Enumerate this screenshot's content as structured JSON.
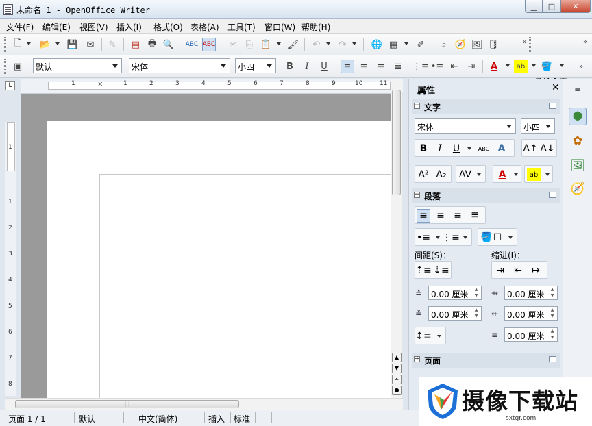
{
  "window": {
    "title": "未命名 1 - OpenOffice Writer"
  },
  "menu": [
    "文件(F)",
    "编辑(E)",
    "视图(V)",
    "插入(I)",
    "格式(O)",
    "表格(A)",
    "工具(T)",
    "窗口(W)",
    "帮助(H)"
  ],
  "toolbar": {
    "find_placeholder": "查找文字"
  },
  "format_bar": {
    "style": "默认",
    "font": "宋体",
    "size": "小四"
  },
  "ruler": {
    "h_ticks": [
      "1",
      "1",
      "2",
      "3",
      "4",
      "5",
      "6",
      "7",
      "8",
      "9",
      "10",
      "11"
    ],
    "v_ticks": [
      "1",
      "1",
      "2",
      "3",
      "4",
      "5",
      "6",
      "7",
      "8"
    ]
  },
  "sidebar": {
    "title": "属性",
    "sections": {
      "text": "文字",
      "paragraph": "段落",
      "page": "页面"
    },
    "font": "宋体",
    "size": "小四",
    "spacing_label": "间距(S)：",
    "indent_label": "缩进(I)：",
    "spin_values": [
      "0.00 厘米",
      "0.00 厘米",
      "0.00 厘米",
      "0.00 厘米",
      "0.00 厘米"
    ]
  },
  "status": {
    "page": "页面 1 / 1",
    "style": "默认",
    "lang": "中文(简体)",
    "mode": "插入",
    "selection": "标准"
  },
  "watermark": {
    "text": "摄像下载站",
    "url": "sxtgr.com"
  },
  "colors": {
    "accent": "#7c9fc7",
    "page_bg": "#9a9a9a",
    "sidebar_bg": "#e3eaf2"
  }
}
